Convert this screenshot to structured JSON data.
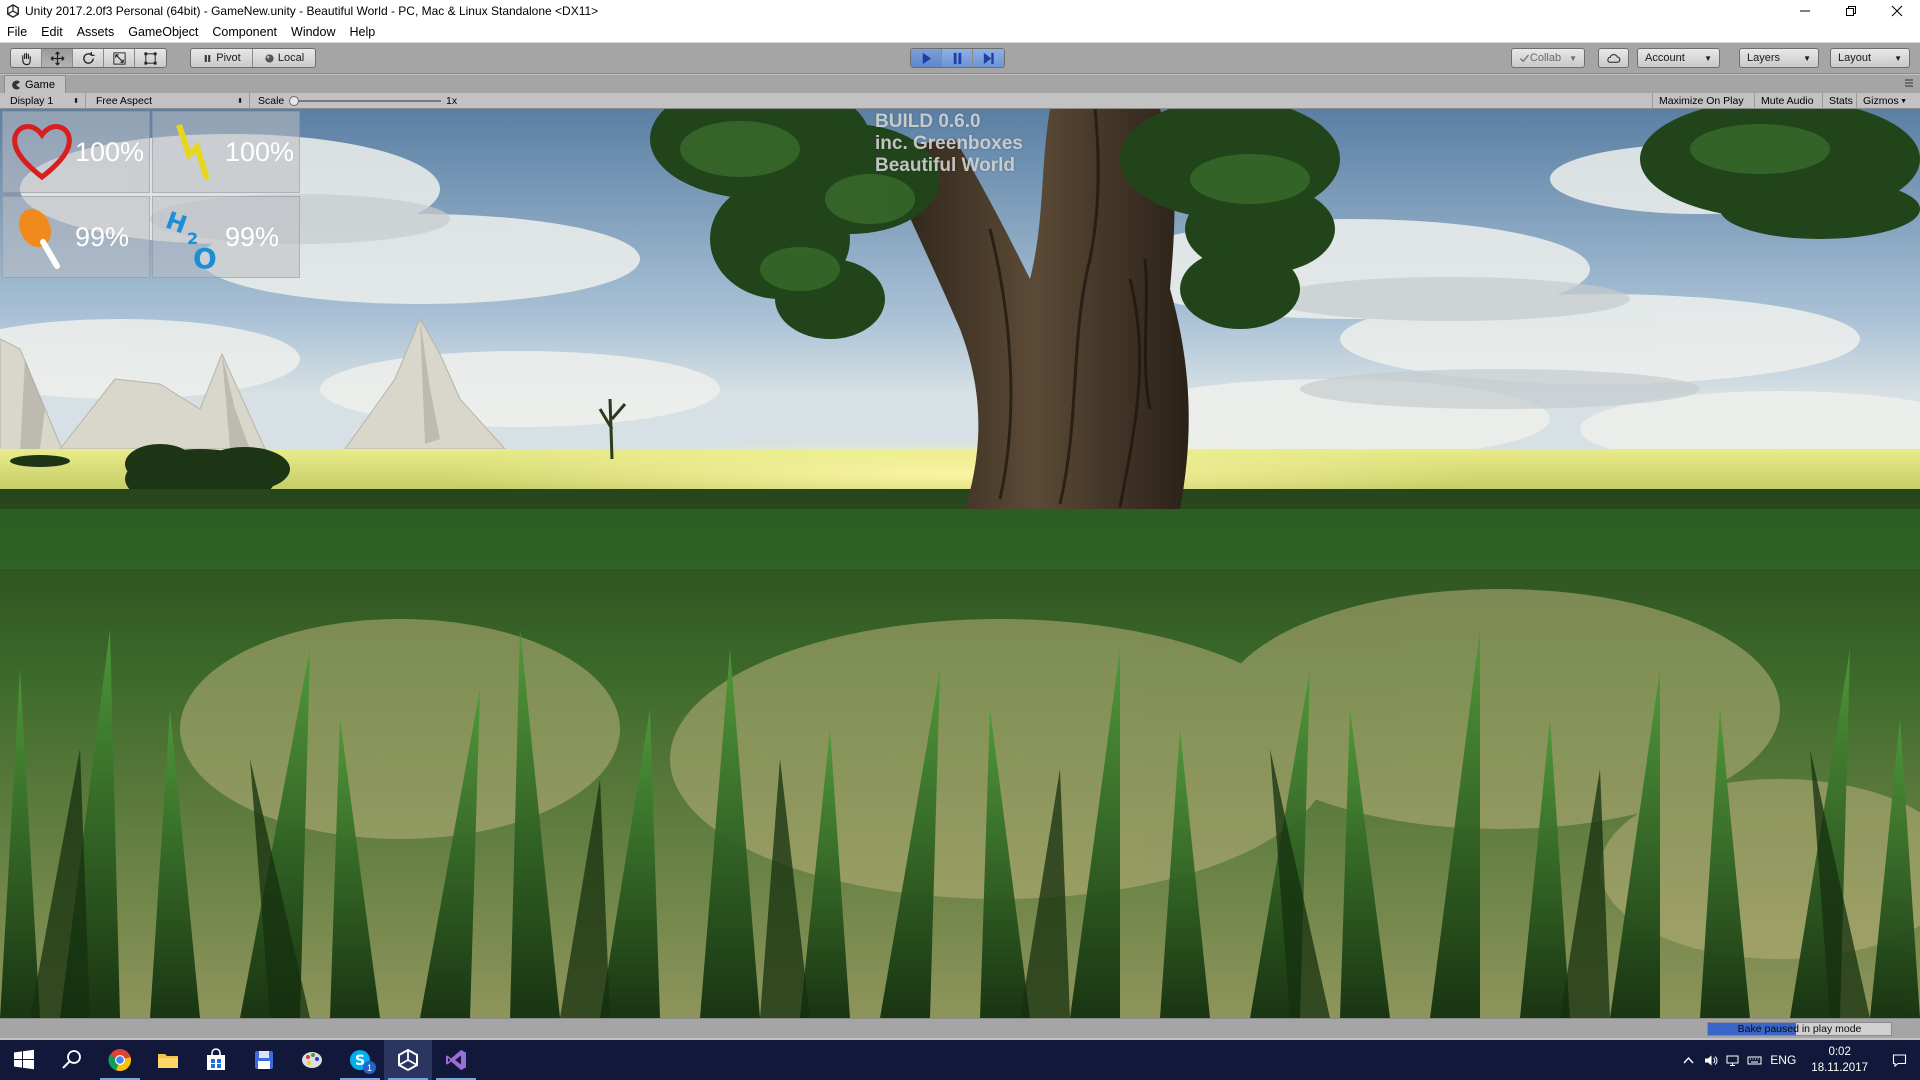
{
  "window": {
    "title": "Unity 2017.2.0f3 Personal (64bit) - GameNew.unity - Beautiful World - PC, Mac & Linux Standalone <DX11>"
  },
  "menu": [
    "File",
    "Edit",
    "Assets",
    "GameObject",
    "Component",
    "Window",
    "Help"
  ],
  "toolbar": {
    "pivot_label": "Pivot",
    "local_label": "Local",
    "collab_label": "Collab",
    "account_label": "Account",
    "layers_label": "Layers",
    "layout_label": "Layout"
  },
  "game_tab": {
    "label": "Game",
    "display_label": "Display 1",
    "aspect_label": "Free Aspect",
    "scale_label": "Scale",
    "scale_value": "1x",
    "maximize_label": "Maximize On Play",
    "mute_label": "Mute Audio",
    "stats_label": "Stats",
    "gizmos_label": "Gizmos"
  },
  "game": {
    "build_line1": "BUILD 0.6.0",
    "build_line2": "inc. Greenboxes",
    "build_line3": "Beautiful World",
    "hud": {
      "health": "100%",
      "energy": "100%",
      "food": "99%",
      "water": "99%"
    },
    "hud_icons": [
      "heart-icon",
      "lightning-icon",
      "drumstick-icon",
      "h2o-icon"
    ]
  },
  "status": {
    "bake_label": "Bake paused in play mode",
    "bake_progress": 0.48
  },
  "taskbar": {
    "lang": "ENG",
    "time": "0:02",
    "date": "18.11.2017",
    "skype_badge": "1"
  },
  "colors": {
    "toolbar_bg": "#a5a5a5",
    "play_active": "#6a8fd1",
    "taskbar_bg": "#12183a",
    "health_red": "#d81e1e",
    "energy_yellow": "#e5d81c",
    "food_orange": "#f08a1c",
    "water_blue": "#1a8fd8"
  }
}
